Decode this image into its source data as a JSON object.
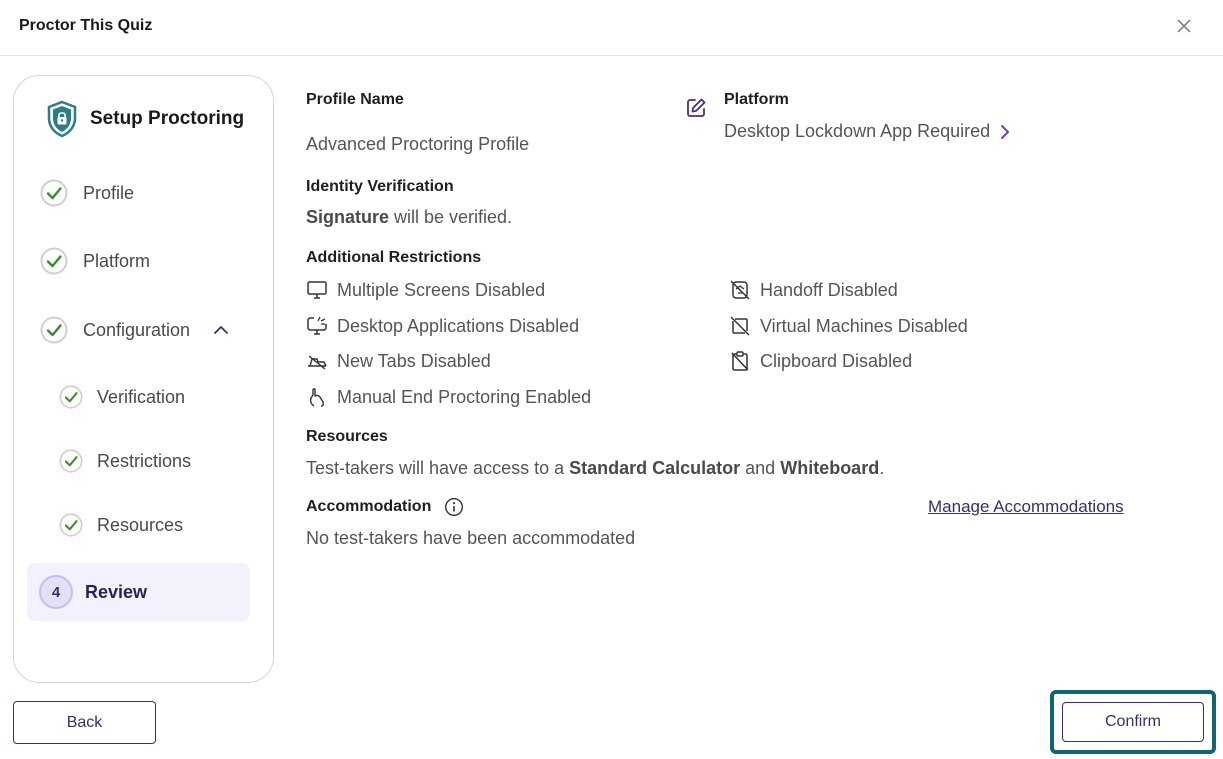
{
  "header": {
    "title": "Proctor This Quiz",
    "close_icon": "close-icon"
  },
  "sidebar": {
    "title": "Setup Proctoring",
    "steps": [
      {
        "label": "Profile",
        "status": "complete"
      },
      {
        "label": "Platform",
        "status": "complete"
      },
      {
        "label": "Configuration",
        "status": "complete",
        "expanded": true
      },
      {
        "label": "Verification",
        "status": "complete"
      },
      {
        "label": "Restrictions",
        "status": "complete"
      },
      {
        "label": "Resources",
        "status": "complete"
      },
      {
        "label": "Review",
        "number": "4",
        "status": "current"
      }
    ]
  },
  "profile": {
    "title": "Profile Name",
    "value": "Advanced Proctoring Profile"
  },
  "platform": {
    "title": "Platform",
    "value": "Desktop Lockdown App Required"
  },
  "identity": {
    "title": "Identity Verification",
    "strong": "Signature",
    "rest": " will be verified."
  },
  "restrictions": {
    "title": "Additional Restrictions",
    "left": [
      {
        "label": "Multiple Screens Disabled",
        "icon": "monitor-icon"
      },
      {
        "label": "Desktop Applications Disabled",
        "icon": "desktop-apps-icon"
      },
      {
        "label": "New Tabs Disabled",
        "icon": "tabs-off-icon"
      },
      {
        "label": "Manual End Proctoring Enabled",
        "icon": "hand-icon"
      }
    ],
    "right": [
      {
        "label": "Handoff Disabled",
        "icon": "handoff-off-icon"
      },
      {
        "label": "Virtual Machines Disabled",
        "icon": "vm-off-icon"
      },
      {
        "label": "Clipboard Disabled",
        "icon": "clipboard-off-icon"
      }
    ]
  },
  "resources": {
    "title": "Resources",
    "text1": "Test-takers will have access to a ",
    "calc": "Standard Calculator",
    "text2": " and ",
    "whiteboard": "Whiteboard",
    "text3": "."
  },
  "accommodation": {
    "title": "Accommodation",
    "value": "No test-takers have been accommodated",
    "manage_link": "Manage Accommodations"
  },
  "footer": {
    "back_label": "Back",
    "confirm_label": "Confirm"
  },
  "colors": {
    "accent": "#3b2d6b",
    "check": "#3a8a2e",
    "highlight": "#0f6673"
  }
}
